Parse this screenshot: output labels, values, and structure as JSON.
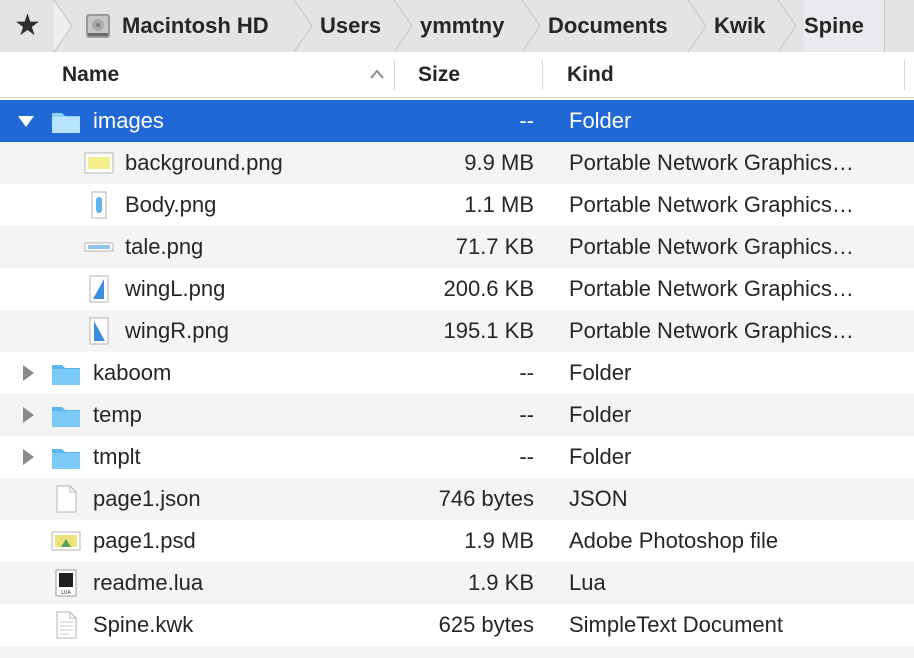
{
  "pathbar": {
    "favorite_icon": "star-icon",
    "crumbs": [
      "Macintosh HD",
      "Users",
      "ymmtny",
      "Documents",
      "Kwik",
      "Spine"
    ]
  },
  "header": {
    "name": "Name",
    "size": "Size",
    "kind": "Kind",
    "sort": "ascending"
  },
  "colors": {
    "selection": "#1f68d5",
    "folder": "#6ec3f4",
    "alt_row": "#f4f4f4",
    "pathbar": "#e4e4e4"
  },
  "rows": [
    {
      "name": "images",
      "size": "--",
      "kind": "Folder",
      "icon": "folder-icon",
      "expanded": true,
      "selected": true
    },
    {
      "name": "background.png",
      "size": "9.9 MB",
      "kind": "Portable Network Graphics…",
      "icon": "png-file-icon"
    },
    {
      "name": "Body.png",
      "size": "1.1 MB",
      "kind": "Portable Network Graphics…",
      "icon": "png-file-icon"
    },
    {
      "name": "tale.png",
      "size": "71.7 KB",
      "kind": "Portable Network Graphics…",
      "icon": "png-file-icon"
    },
    {
      "name": "wingL.png",
      "size": "200.6 KB",
      "kind": "Portable Network Graphics…",
      "icon": "png-file-icon"
    },
    {
      "name": "wingR.png",
      "size": "195.1 KB",
      "kind": "Portable Network Graphics…",
      "icon": "png-file-icon"
    },
    {
      "name": "kaboom",
      "size": "--",
      "kind": "Folder",
      "icon": "folder-icon",
      "expanded": false
    },
    {
      "name": "temp",
      "size": "--",
      "kind": "Folder",
      "icon": "folder-icon",
      "expanded": false
    },
    {
      "name": "tmplt",
      "size": "--",
      "kind": "Folder",
      "icon": "folder-icon",
      "expanded": false
    },
    {
      "name": "page1.json",
      "size": "746 bytes",
      "kind": "JSON",
      "icon": "document-icon"
    },
    {
      "name": "page1.psd",
      "size": "1.9 MB",
      "kind": "Adobe Photoshop file",
      "icon": "psd-file-icon"
    },
    {
      "name": "readme.lua",
      "size": "1.9 KB",
      "kind": "Lua",
      "icon": "lua-file-icon",
      "icon_label": "LUA"
    },
    {
      "name": "Spine.kwk",
      "size": "625 bytes",
      "kind": "SimpleText Document",
      "icon": "text-document-icon"
    }
  ]
}
